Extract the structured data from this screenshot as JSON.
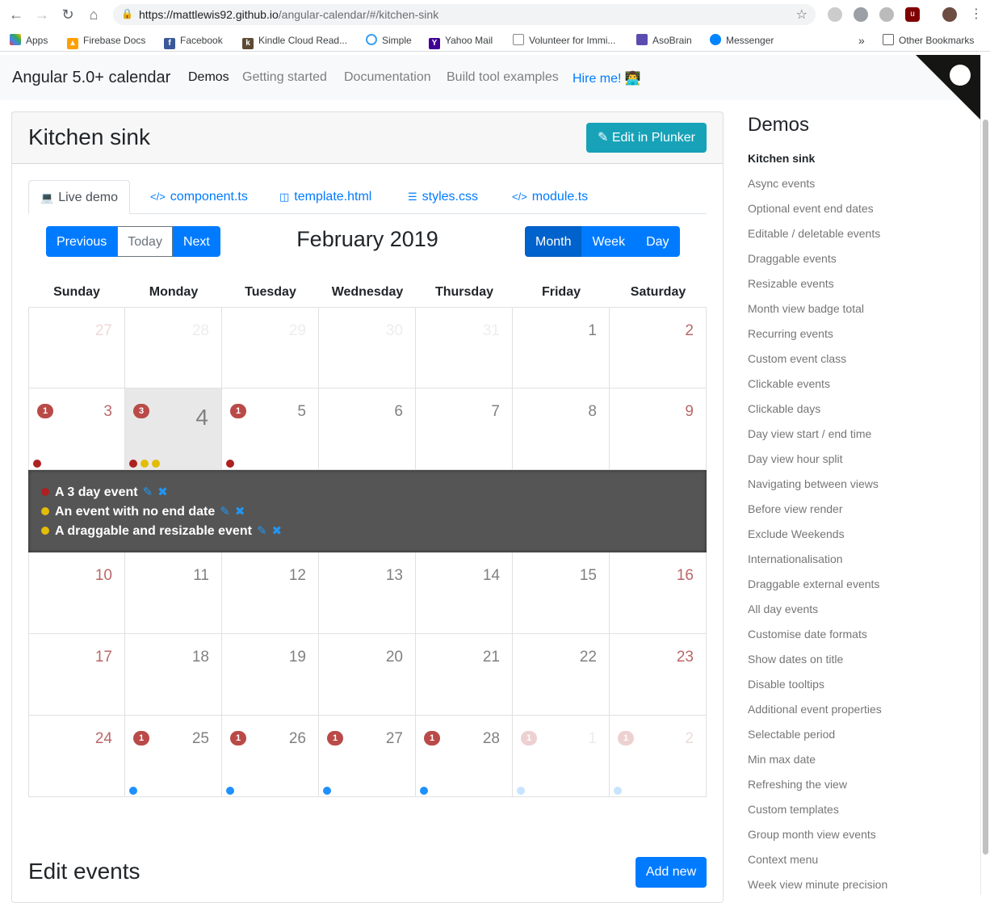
{
  "browser": {
    "url_host": "https://mattlewis92.github.io",
    "url_path": "/angular-calendar/#/kitchen-sink",
    "bookmarks": [
      {
        "label": "Apps",
        "icon": "apps-grid-icon",
        "color": "#ea4335"
      },
      {
        "label": "Firebase Docs",
        "icon": "firebase-icon",
        "color": "#ffa000"
      },
      {
        "label": "Facebook",
        "icon": "facebook-icon",
        "color": "#3b5998"
      },
      {
        "label": "Kindle Cloud Read...",
        "icon": "kindle-icon",
        "color": "#5c4a33"
      },
      {
        "label": "Simple",
        "icon": "simple-icon",
        "color": "#3aa0f3"
      },
      {
        "label": "Yahoo Mail",
        "icon": "yahoo-icon",
        "color": "#410093"
      },
      {
        "label": "Volunteer for Immi...",
        "icon": "page-icon",
        "color": "#888888"
      },
      {
        "label": "AsoBrain",
        "icon": "asobrain-icon",
        "color": "#5b4caf"
      },
      {
        "label": "Messenger",
        "icon": "messenger-icon",
        "color": "#0084ff"
      }
    ],
    "more_bookmarks": "»",
    "other_bookmarks": "Other Bookmarks"
  },
  "navbar": {
    "brand": "Angular 5.0+ calendar",
    "links": [
      "Demos",
      "Getting started",
      "Documentation",
      "Build tool examples",
      "Hire me! 👨‍💻"
    ]
  },
  "card": {
    "title": "Kitchen sink",
    "plunker_label": "Edit in Plunker",
    "tabs": [
      {
        "label": "Live demo",
        "icon": "laptop-icon"
      },
      {
        "label": "component.ts",
        "icon": "code-icon"
      },
      {
        "label": "template.html",
        "icon": "html5-icon"
      },
      {
        "label": "styles.css",
        "icon": "css3-icon"
      },
      {
        "label": "module.ts",
        "icon": "code-icon"
      }
    ]
  },
  "calendar": {
    "nav": {
      "previous": "Previous",
      "today": "Today",
      "next": "Next"
    },
    "title": "February 2019",
    "views": {
      "month": "Month",
      "week": "Week",
      "day": "Day",
      "active": "Month"
    },
    "weekdays": [
      "Sunday",
      "Monday",
      "Tuesday",
      "Wednesday",
      "Thursday",
      "Friday",
      "Saturday"
    ],
    "colors": {
      "red": "#ad2121",
      "yellow": "#e3bc08",
      "blue": "#1e90ff"
    },
    "weeks": [
      [
        {
          "n": "27",
          "out": true
        },
        {
          "n": "28",
          "out": true
        },
        {
          "n": "29",
          "out": true
        },
        {
          "n": "30",
          "out": true
        },
        {
          "n": "31",
          "out": true
        },
        {
          "n": "1"
        },
        {
          "n": "2"
        }
      ],
      [
        {
          "n": "3",
          "badge": "1",
          "dots": [
            "red"
          ]
        },
        {
          "n": "4",
          "badge": "3",
          "dots": [
            "red",
            "yellow",
            "yellow"
          ],
          "today": true
        },
        {
          "n": "5",
          "badge": "1",
          "dots": [
            "red"
          ]
        },
        {
          "n": "6"
        },
        {
          "n": "7"
        },
        {
          "n": "8"
        },
        {
          "n": "9"
        }
      ],
      [
        {
          "n": "10"
        },
        {
          "n": "11"
        },
        {
          "n": "12"
        },
        {
          "n": "13"
        },
        {
          "n": "14"
        },
        {
          "n": "15"
        },
        {
          "n": "16"
        }
      ],
      [
        {
          "n": "17"
        },
        {
          "n": "18"
        },
        {
          "n": "19"
        },
        {
          "n": "20"
        },
        {
          "n": "21"
        },
        {
          "n": "22"
        },
        {
          "n": "23"
        }
      ],
      [
        {
          "n": "24"
        },
        {
          "n": "25",
          "badge": "1",
          "dots": [
            "blue"
          ]
        },
        {
          "n": "26",
          "badge": "1",
          "dots": [
            "blue"
          ]
        },
        {
          "n": "27",
          "badge": "1",
          "dots": [
            "blue"
          ]
        },
        {
          "n": "28",
          "badge": "1",
          "dots": [
            "blue"
          ]
        },
        {
          "n": "1",
          "out": true,
          "badge": "1",
          "dots": [
            "blue"
          ]
        },
        {
          "n": "2",
          "out": true,
          "badge": "1",
          "dots": [
            "blue"
          ]
        }
      ]
    ],
    "open_day_events": [
      {
        "title": "A 3 day event",
        "color": "red"
      },
      {
        "title": "An event with no end date",
        "color": "yellow"
      },
      {
        "title": "A draggable and resizable event",
        "color": "yellow"
      }
    ]
  },
  "edit_events": {
    "title": "Edit events",
    "add_label": "Add new"
  },
  "sidebar": {
    "title": "Demos",
    "items": [
      "Kitchen sink",
      "Async events",
      "Optional event end dates",
      "Editable / deletable events",
      "Draggable events",
      "Resizable events",
      "Month view badge total",
      "Recurring events",
      "Custom event class",
      "Clickable events",
      "Clickable days",
      "Day view start / end time",
      "Day view hour split",
      "Navigating between views",
      "Before view render",
      "Exclude Weekends",
      "Internationalisation",
      "Draggable external events",
      "All day events",
      "Customise date formats",
      "Show dates on title",
      "Disable tooltips",
      "Additional event properties",
      "Selectable period",
      "Min max date",
      "Refreshing the view",
      "Custom templates",
      "Group month view events",
      "Context menu",
      "Week view minute precision"
    ]
  }
}
